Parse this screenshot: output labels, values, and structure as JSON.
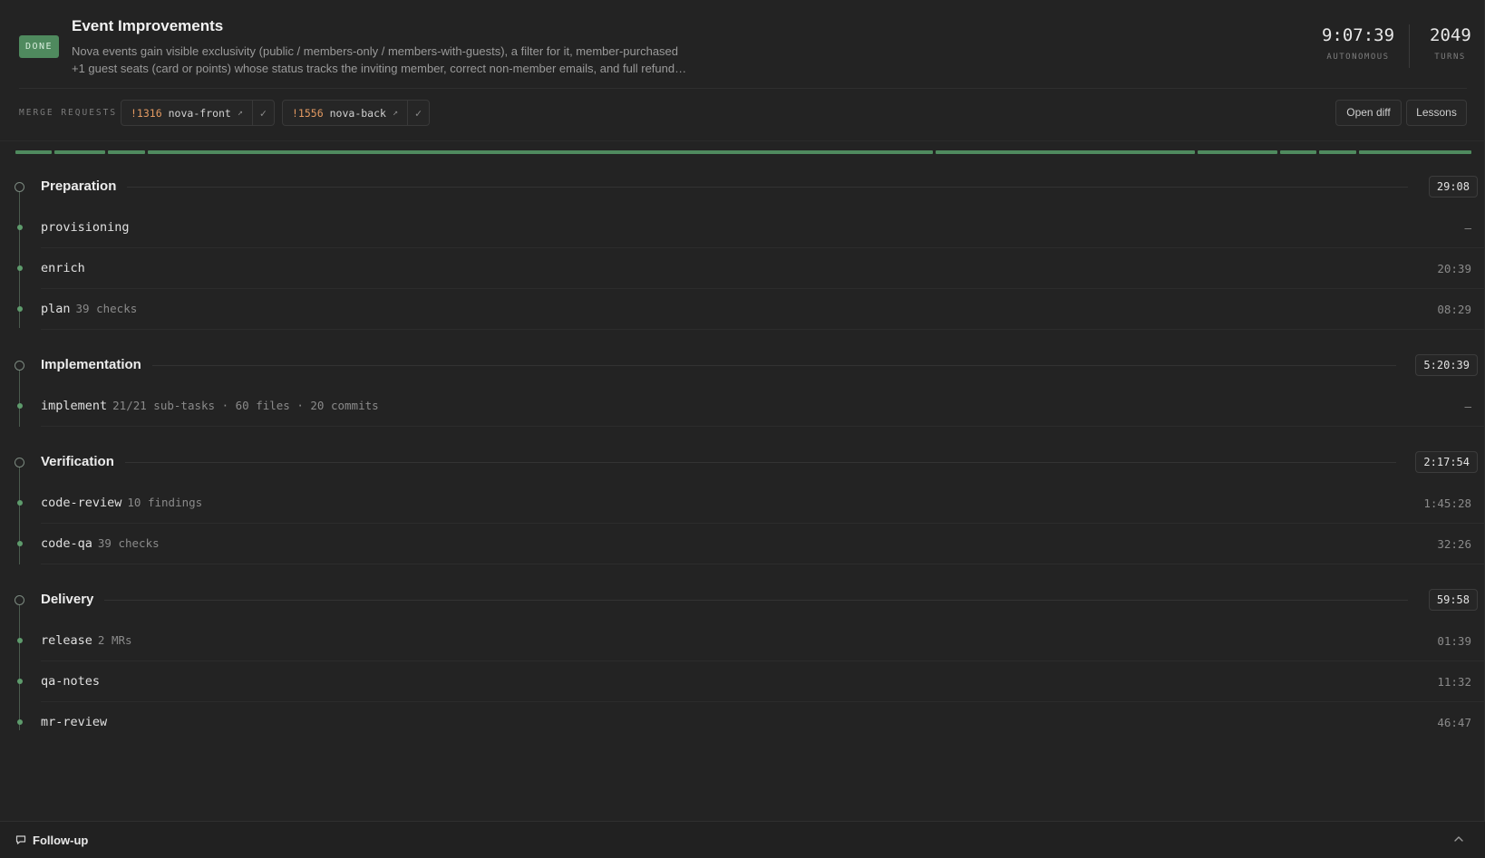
{
  "header": {
    "status": "DONE",
    "title": "Event Improvements",
    "description_line1": "Nova events gain visible exclusivity (public / members-only / members-with-guests), a filter for it, member-purchased",
    "description_line2": "+1 guest seats (card or points) whose status tracks the inviting member, correct non-member emails, and full refund…",
    "autonomous_time": "9:07:39",
    "autonomous_label": "AUTONOMOUS",
    "turns_value": "2049",
    "turns_label": "TURNS"
  },
  "merge_requests": {
    "label": "MERGE REQUESTS",
    "items": [
      {
        "number": "!1316",
        "repo": "nova-front"
      },
      {
        "number": "!1556",
        "repo": "nova-back"
      }
    ],
    "open_diff_label": "Open diff",
    "lessons_label": "Lessons"
  },
  "phases": [
    {
      "title": "Preparation",
      "time": "29:08",
      "steps": [
        {
          "name": "provisioning",
          "meta": "",
          "time": "–"
        },
        {
          "name": "enrich",
          "meta": "",
          "time": "20:39"
        },
        {
          "name": "plan",
          "meta": "39 checks",
          "time": "08:29"
        }
      ]
    },
    {
      "title": "Implementation",
      "time": "5:20:39",
      "steps": [
        {
          "name": "implement",
          "meta": "21/21 sub-tasks · 60 files · 20 commits",
          "time": "–"
        }
      ]
    },
    {
      "title": "Verification",
      "time": "2:17:54",
      "steps": [
        {
          "name": "code-review",
          "meta": "10 findings",
          "time": "1:45:28"
        },
        {
          "name": "code-qa",
          "meta": "39 checks",
          "time": "32:26"
        }
      ]
    },
    {
      "title": "Delivery",
      "time": "59:58",
      "steps": [
        {
          "name": "release",
          "meta": "2 MRs",
          "time": "01:39"
        },
        {
          "name": "qa-notes",
          "meta": "",
          "time": "11:32"
        },
        {
          "name": "mr-review",
          "meta": "",
          "time": "46:47"
        }
      ]
    }
  ],
  "footer": {
    "label": "Follow-up"
  },
  "colors": {
    "accent_green": "#4f8a5e",
    "mr_number": "#e39a62",
    "background": "#232323"
  },
  "icons": [
    "external-link-icon",
    "check-icon",
    "chat-bubble-icon",
    "chevron-up-icon"
  ]
}
